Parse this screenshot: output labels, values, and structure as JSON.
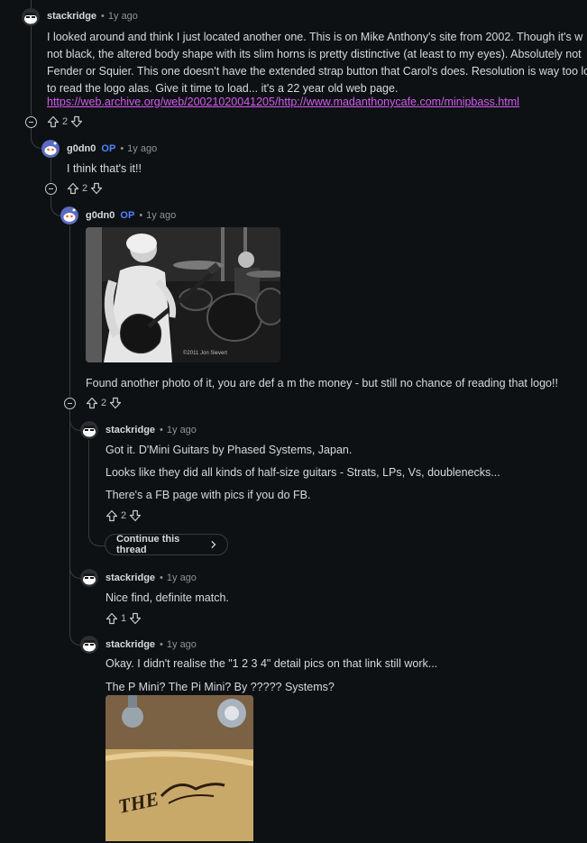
{
  "comments": [
    {
      "author": "stackridge",
      "time": "1y ago",
      "paragraphs": [
        "I looked around and think I just located another one. This is on Mike Anthony's site from 2002. Though it's w",
        "not black, the altered body shape with its slim horns is pretty distinctive (at least to my eyes). Absolutely not",
        "Fender or Squier. This one doesn't have the extended strap button that Carol's does. Resolution is way too lo",
        "to read the logo alas. Give it time to load... it's a 22 year old web page."
      ],
      "link": "https://web.archive.org/web/20021020041205/http://www.madanthonycafe.com/minipbass.html",
      "votes": "2"
    },
    {
      "author": "g0dn0",
      "op": "OP",
      "time": "1y ago",
      "paragraphs": [
        "I think that's it!!"
      ],
      "votes": "2"
    },
    {
      "author": "g0dn0",
      "op": "OP",
      "time": "1y ago",
      "image_credit": "©2011 Jon Sievert",
      "paragraphs": [
        "Found another photo of it, you are def a m the money - but still no chance of reading that logo!!"
      ],
      "votes": "2"
    },
    {
      "author": "stackridge",
      "time": "1y ago",
      "paragraphs": [
        "Got it. D'Mini Guitars by Phased Systems, Japan.",
        "Looks like they did all kinds of half-size guitars - Strats, LPs, Vs, doublenecks...",
        "There's a FB page with pics if you do FB."
      ],
      "votes": "2",
      "continue_label": "Continue this thread"
    },
    {
      "author": "stackridge",
      "time": "1y ago",
      "paragraphs": [
        "Nice find, definite match."
      ],
      "votes": "1"
    },
    {
      "author": "stackridge",
      "time": "1y ago",
      "paragraphs": [
        "Okay. I didn't realise the \"1 2 3 4\" detail pics on that link still work...",
        "The P Mini? The Pi Mini? By ????? Systems?"
      ],
      "image_text": "THE"
    }
  ],
  "separator": "•",
  "icons": {
    "upvote": "upvote-arrow-icon",
    "downvote": "downvote-arrow-icon",
    "collapse": "collapse-minus-icon",
    "chevron": "chevron-right-icon"
  },
  "colors": {
    "background": "#0e1113",
    "link": "#d35bf2",
    "op_badge": "#4f83ff",
    "thread_line": "#3a3d40"
  }
}
